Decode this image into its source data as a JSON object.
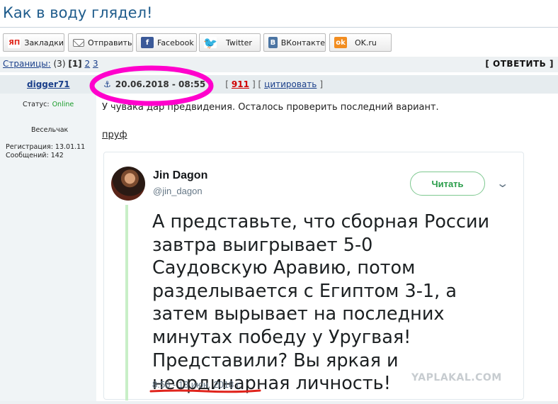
{
  "topic": {
    "title": "Как в воду глядел!"
  },
  "share": [
    {
      "icon": "yandex-bookmarks-icon",
      "glyph": "ЯП",
      "label": "Закладки"
    },
    {
      "icon": "mail-icon",
      "glyph": "",
      "label": "Отправить"
    },
    {
      "icon": "facebook-icon",
      "glyph": "f",
      "label": "Facebook"
    },
    {
      "icon": "twitter-icon",
      "glyph": "🐦",
      "label": "Twitter"
    },
    {
      "icon": "vk-icon",
      "glyph": "В",
      "label": "ВКонтакте"
    },
    {
      "icon": "ok-icon",
      "glyph": "ok",
      "label": "OK.ru"
    }
  ],
  "pages": {
    "label": "Страницы:",
    "count": "(3)",
    "current": "[1]",
    "p2": "2",
    "p3": "3"
  },
  "reply_label": "[ ОТВЕТИТЬ ]",
  "post": {
    "author": "digger71",
    "anchor_glyph": "⚓",
    "date": "20.06.2018 - 08:55",
    "number": "911",
    "quote_label": "цитировать",
    "text": "У чувака дар предвидения. Осталось проверить последний вариант.",
    "proof_link": "пруф"
  },
  "user": {
    "status_label": "Статус:",
    "status_value": "Online",
    "rank": "Весельчак",
    "registration": "Регистрация: 13.01.11",
    "messages": "Сообщений: 142"
  },
  "tweet": {
    "name": "Jin Dagon",
    "handle": "@jin_dagon",
    "follow_label": "Читать",
    "chevron": "⌄",
    "body": "А представьте, что сборная России завтра выигрывает 5-0 Саудовскую Аравию, потом разделывается с Египтом 3-1, а затем вырывает на последних минутах победу у Уругвая! Представили? Вы яркая и неординарная личность!",
    "time": "8:56 - 13 июн. 2018 г."
  },
  "watermark": "YAPLAKAL.COM",
  "colors": {
    "highlight": "#ff00cc",
    "underline": "#e0241c",
    "link": "#1a3f8a",
    "online": "#1a9b2a"
  }
}
